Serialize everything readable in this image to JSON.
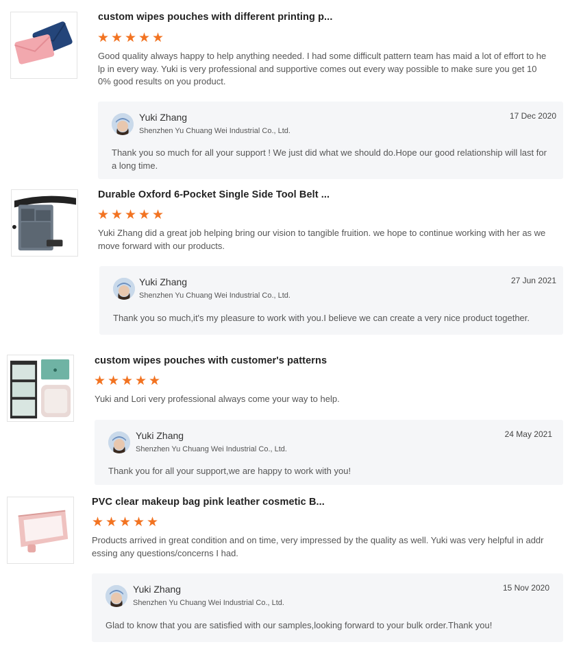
{
  "reviews": [
    {
      "product_title": "custom wipes pouches with different printing p...",
      "rating": 5,
      "review_text": "Good quality always happy to help anything needed. I had some difficult pattern team has maid a lot of effort to help in every way. Yuki is very professional and supportive comes out every way possible to make sure you get 100% good results on you product.",
      "reply": {
        "name": "Yuki Zhang",
        "company": "Shenzhen Yu Chuang Wei Industrial Co., Ltd.",
        "date": "17 Dec 2020",
        "text": "Thank you so much for all your support ! We just did what we should do.Hope our good relationship will last for a long time."
      }
    },
    {
      "product_title": "Durable Oxford 6-Pocket Single Side Tool Belt ...",
      "rating": 5,
      "review_text": "Yuki Zhang did a great job helping bring our vision to tangible fruition. we hope to continue working with her as we move forward with our products.",
      "reply": {
        "name": "Yuki Zhang",
        "company": "Shenzhen Yu Chuang Wei Industrial Co., Ltd.",
        "date": "27 Jun 2021",
        "text": "Thank you so much,it's my pleasure to work with you.I believe we can create a very nice product together."
      }
    },
    {
      "product_title": "custom wipes pouches with customer's patterns",
      "rating": 5,
      "review_text": "Yuki and Lori very professional always come your way to help.",
      "reply": {
        "name": "Yuki Zhang",
        "company": "Shenzhen Yu Chuang Wei Industrial Co., Ltd.",
        "date": "24 May 2021",
        "text": "Thank you for all your support,we are happy to work with you!"
      }
    },
    {
      "product_title": "PVC clear makeup bag pink leather cosmetic B...",
      "rating": 5,
      "review_text": "Products arrived in great condition and on time, very impressed by the quality as well. Yuki was very helpful in addressing any questions/concerns I had.",
      "reply": {
        "name": "Yuki Zhang",
        "company": "Shenzhen Yu Chuang Wei Industrial Co., Ltd.",
        "date": "15 Nov 2020",
        "text": "Glad to know that you are satisfied with our samples,looking forward to your bulk order.Thank you!"
      }
    }
  ],
  "colors": {
    "star": "#f27321",
    "reply_bg": "#f5f6f8"
  },
  "icons": {
    "star": "star-icon",
    "avatar": "user-avatar"
  }
}
